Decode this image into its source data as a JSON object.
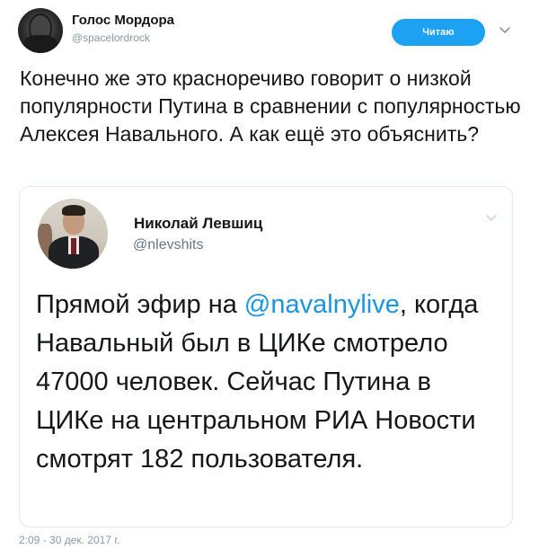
{
  "tweet": {
    "author_name": "Голос Мордора",
    "author_handle": "@spacelordrock",
    "follow_label": "Читаю",
    "text": "Конечно же это красноречиво говорит о низкой популярности Путина в сравнении с популярностью Алексея Навального. А как ещё это объяснить?",
    "timestamp": "2:09 - 30 дек. 2017 г."
  },
  "quoted_tweet": {
    "author_name": "Николай Левшиц",
    "author_handle": "@nlevshits",
    "text_before_mention": "Прямой эфир на ",
    "mention": "@navalnylive",
    "text_after_mention": ", когда Навальный был в ЦИКе смотрело 47000 человек. Сейчас Путина в ЦИКе на центральном РИА Новости смотрят 182 пользователя."
  },
  "icons": {
    "main_avatar": "avatar-icon",
    "quote_avatar": "avatar-icon",
    "menu": "chevron-down-icon"
  },
  "colors": {
    "accent": "#1da1f2",
    "mention": "#1b95e0",
    "muted": "#8899a6",
    "border": "#e1e8ed"
  }
}
